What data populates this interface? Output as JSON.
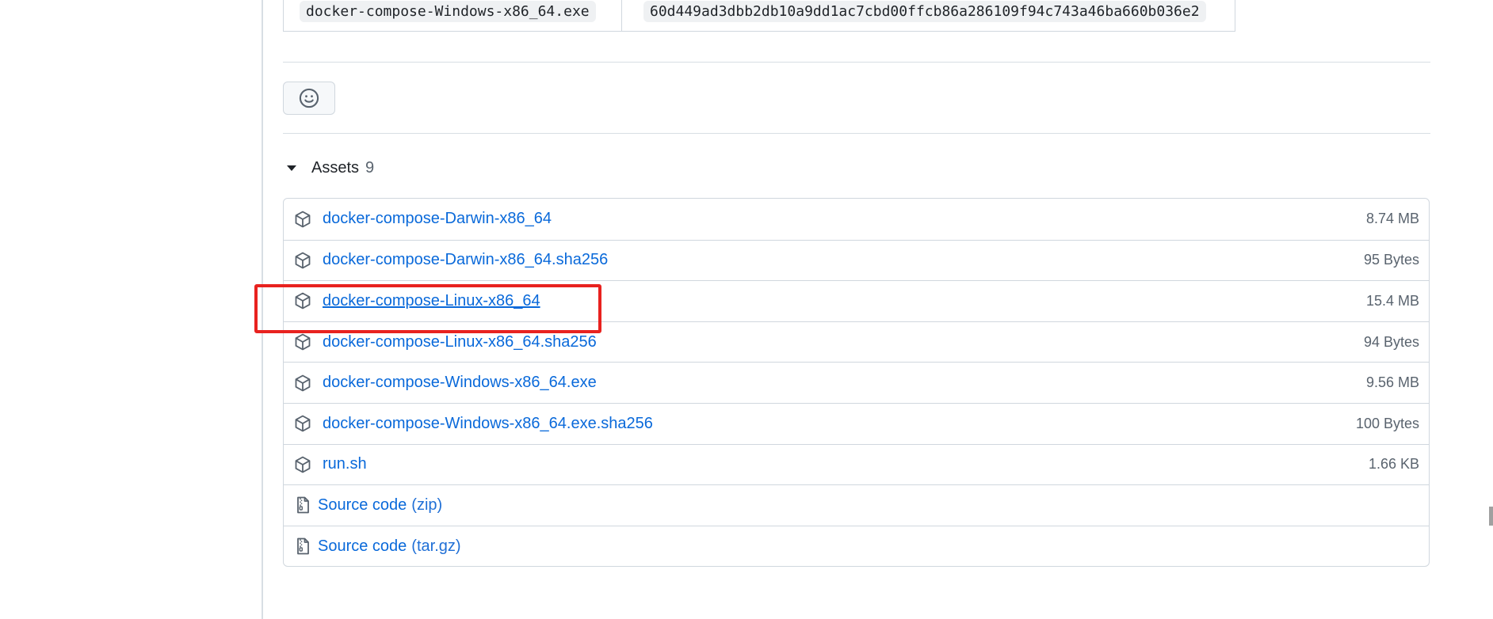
{
  "checksum_row": {
    "file": "docker-compose-Windows-x86_64.exe",
    "hash": "60d449ad3dbb2db10a9dd1ac7cbd00ffcb86a286109f94c743a46ba660b036e2"
  },
  "reaction": {
    "icon": "smiley-icon"
  },
  "assets": {
    "title": "Assets",
    "count": "9",
    "items": [
      {
        "name": "docker-compose-Darwin-x86_64",
        "size": "8.74 MB",
        "icon": "package-icon"
      },
      {
        "name": "docker-compose-Darwin-x86_64.sha256",
        "size": "95 Bytes",
        "icon": "package-icon"
      },
      {
        "name": "docker-compose-Linux-x86_64",
        "size": "15.4 MB",
        "icon": "package-icon"
      },
      {
        "name": "docker-compose-Linux-x86_64.sha256",
        "size": "94 Bytes",
        "icon": "package-icon"
      },
      {
        "name": "docker-compose-Windows-x86_64.exe",
        "size": "9.56 MB",
        "icon": "package-icon"
      },
      {
        "name": "docker-compose-Windows-x86_64.exe.sha256",
        "size": "100 Bytes",
        "icon": "package-icon"
      },
      {
        "name": "run.sh",
        "size": "1.66 KB",
        "icon": "package-icon"
      }
    ],
    "source": [
      {
        "label": "Source code",
        "suffix": "(zip)",
        "icon": "file-zip-icon"
      },
      {
        "label": "Source code",
        "suffix": "(tar.gz)",
        "icon": "file-zip-icon"
      }
    ]
  },
  "colors": {
    "link": "#0969da",
    "highlight": "#e8221f",
    "border": "#d0d7de"
  }
}
